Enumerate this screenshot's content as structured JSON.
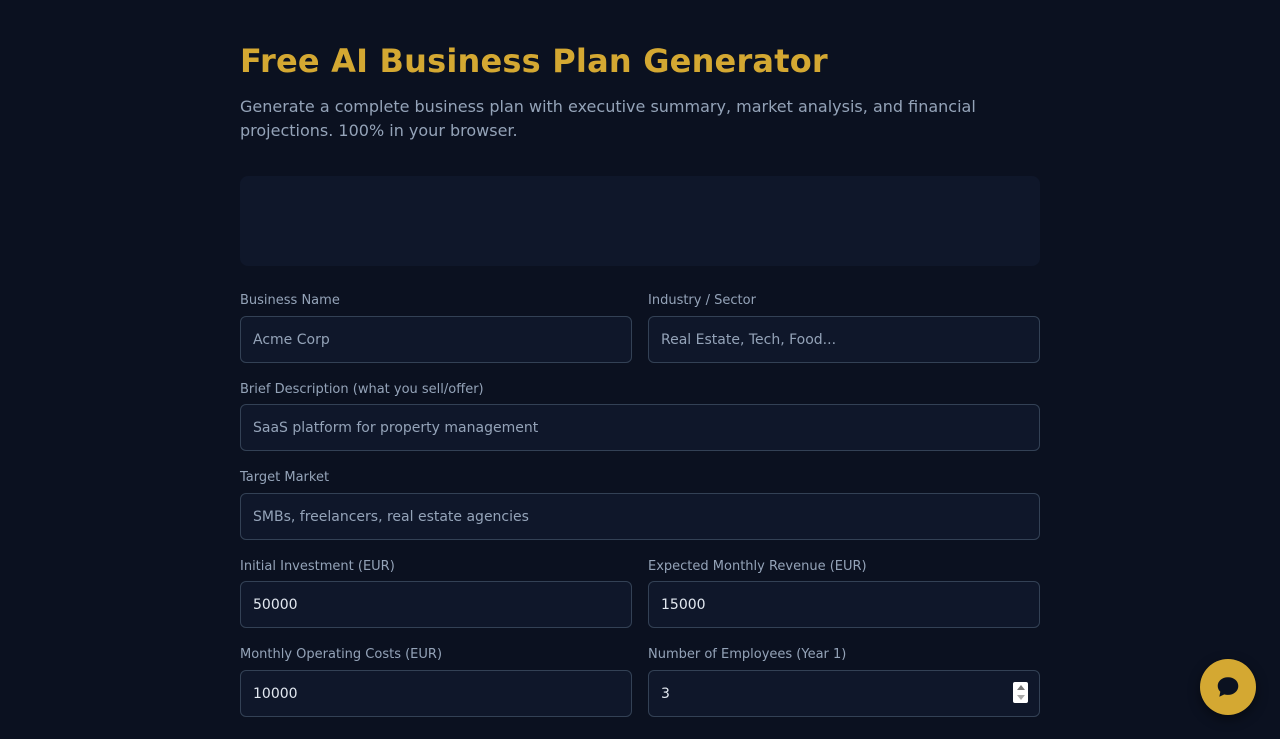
{
  "header": {
    "title": "Free AI Business Plan Generator",
    "subtitle": "Generate a complete business plan with executive summary, market analysis, and financial projections. 100% in your browser."
  },
  "form": {
    "business_name": {
      "label": "Business Name",
      "placeholder": "Acme Corp",
      "value": ""
    },
    "industry": {
      "label": "Industry / Sector",
      "placeholder": "Real Estate, Tech, Food...",
      "value": ""
    },
    "description": {
      "label": "Brief Description (what you sell/offer)",
      "placeholder": "SaaS platform for property management",
      "value": ""
    },
    "target_market": {
      "label": "Target Market",
      "placeholder": "SMBs, freelancers, real estate agencies",
      "value": ""
    },
    "initial_investment": {
      "label": "Initial Investment (EUR)",
      "value": "50000"
    },
    "monthly_revenue": {
      "label": "Expected Monthly Revenue (EUR)",
      "value": "15000"
    },
    "operating_costs": {
      "label": "Monthly Operating Costs (EUR)",
      "value": "10000"
    },
    "employees": {
      "label": "Number of Employees (Year 1)",
      "value": "3"
    }
  },
  "chat": {
    "icon": "chat-bubble-icon"
  },
  "colors": {
    "background": "#0b1120",
    "accent": "#d4a832",
    "panel": "#0f172a",
    "border": "#334155",
    "muted_text": "#94a3b8"
  }
}
